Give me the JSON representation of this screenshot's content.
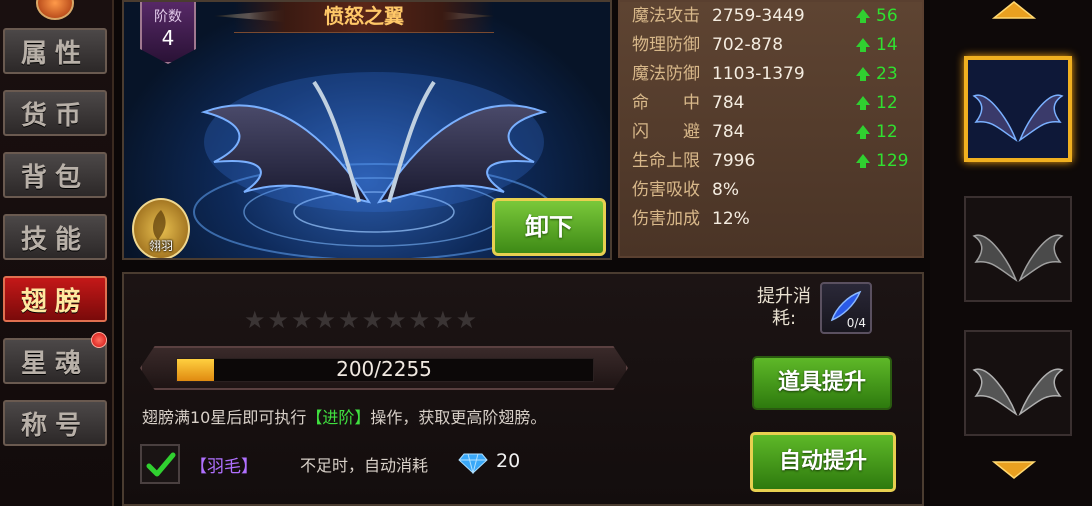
{
  "nav": {
    "items": [
      {
        "label": "属性",
        "active": false
      },
      {
        "label": "货币",
        "active": false
      },
      {
        "label": "背包",
        "active": false
      },
      {
        "label": "技能",
        "active": false
      },
      {
        "label": "翅膀",
        "active": true
      },
      {
        "label": "星魂",
        "active": false,
        "notification": true
      },
      {
        "label": "称号",
        "active": false
      }
    ]
  },
  "wing": {
    "tier_label": "阶数",
    "tier_value": "4",
    "name": "愤怒之翼",
    "feather_badge": "翎羽",
    "unequip_label": "卸下"
  },
  "stats": [
    {
      "name": "魔法攻击",
      "value": "2759-3449",
      "bonus": "56"
    },
    {
      "name": "物理防御",
      "value": "702-878",
      "bonus": "14"
    },
    {
      "name": "魔法防御",
      "value": "1103-1379",
      "bonus": "23"
    },
    {
      "name": "命　　中",
      "value": "784",
      "bonus": "12"
    },
    {
      "name": "闪　　避",
      "value": "784",
      "bonus": "12"
    },
    {
      "name": "生命上限",
      "value": "7996",
      "bonus": "129"
    },
    {
      "name": "伤害吸收",
      "value": "8%",
      "bonus": null
    },
    {
      "name": "伤害加成",
      "value": "12%",
      "bonus": null
    }
  ],
  "upgrade": {
    "stars_filled": 0,
    "stars_total": 10,
    "progress_text": "200/2255",
    "progress_current": 200,
    "progress_max": 2255,
    "note_prefix": "翅膀满10星后即可执行",
    "note_highlight": "【进阶】",
    "note_suffix": "操作，获取更高阶翅膀。",
    "auto_checked": true,
    "feather_option": "【羽毛】",
    "auto_consume_text": "不足时，自动消耗",
    "diamond_count": "20",
    "cost_label": "提升消耗:",
    "cost_item_count": "0/4",
    "item_upgrade_label": "道具提升",
    "auto_upgrade_label": "自动提升"
  },
  "colors": {
    "accent_gold": "#f0b020",
    "bonus_green": "#30e030",
    "active_tab_red": "#c41818"
  }
}
